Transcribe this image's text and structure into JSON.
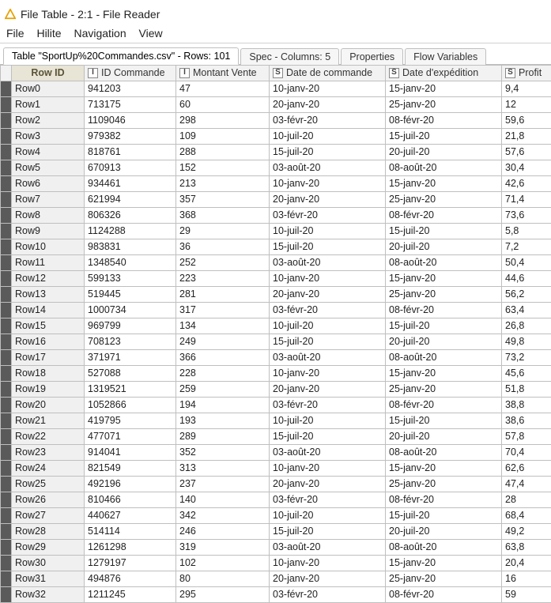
{
  "window": {
    "title": "File Table - 2:1 - File Reader"
  },
  "menu": {
    "items": [
      "File",
      "Hilite",
      "Navigation",
      "View"
    ]
  },
  "tabs": [
    {
      "label": "Table \"SportUp%20Commandes.csv\" - Rows: 101",
      "active": true
    },
    {
      "label": "Spec - Columns: 5",
      "active": false
    },
    {
      "label": "Properties",
      "active": false
    },
    {
      "label": "Flow Variables",
      "active": false
    }
  ],
  "table": {
    "rowid_header": "Row ID",
    "columns": [
      {
        "type": "I",
        "label": "ID Commande"
      },
      {
        "type": "I",
        "label": "Montant Vente"
      },
      {
        "type": "S",
        "label": "Date de commande"
      },
      {
        "type": "S",
        "label": "Date d'expédition"
      },
      {
        "type": "S",
        "label": "Profit"
      }
    ],
    "rows": [
      {
        "id": "Row0",
        "c": [
          "941203",
          "47",
          "10-janv-20",
          "15-janv-20",
          "9,4"
        ]
      },
      {
        "id": "Row1",
        "c": [
          "713175",
          "60",
          "20-janv-20",
          "25-janv-20",
          "12"
        ]
      },
      {
        "id": "Row2",
        "c": [
          "1109046",
          "298",
          "03-févr-20",
          "08-févr-20",
          "59,6"
        ]
      },
      {
        "id": "Row3",
        "c": [
          "979382",
          "109",
          "10-juil-20",
          "15-juil-20",
          "21,8"
        ]
      },
      {
        "id": "Row4",
        "c": [
          "818761",
          "288",
          "15-juil-20",
          "20-juil-20",
          "57,6"
        ]
      },
      {
        "id": "Row5",
        "c": [
          "670913",
          "152",
          "03-août-20",
          "08-août-20",
          "30,4"
        ]
      },
      {
        "id": "Row6",
        "c": [
          "934461",
          "213",
          "10-janv-20",
          "15-janv-20",
          "42,6"
        ]
      },
      {
        "id": "Row7",
        "c": [
          "621994",
          "357",
          "20-janv-20",
          "25-janv-20",
          "71,4"
        ]
      },
      {
        "id": "Row8",
        "c": [
          "806326",
          "368",
          "03-févr-20",
          "08-févr-20",
          "73,6"
        ]
      },
      {
        "id": "Row9",
        "c": [
          "1124288",
          "29",
          "10-juil-20",
          "15-juil-20",
          "5,8"
        ]
      },
      {
        "id": "Row10",
        "c": [
          "983831",
          "36",
          "15-juil-20",
          "20-juil-20",
          "7,2"
        ]
      },
      {
        "id": "Row11",
        "c": [
          "1348540",
          "252",
          "03-août-20",
          "08-août-20",
          "50,4"
        ]
      },
      {
        "id": "Row12",
        "c": [
          "599133",
          "223",
          "10-janv-20",
          "15-janv-20",
          "44,6"
        ]
      },
      {
        "id": "Row13",
        "c": [
          "519445",
          "281",
          "20-janv-20",
          "25-janv-20",
          "56,2"
        ]
      },
      {
        "id": "Row14",
        "c": [
          "1000734",
          "317",
          "03-févr-20",
          "08-févr-20",
          "63,4"
        ]
      },
      {
        "id": "Row15",
        "c": [
          "969799",
          "134",
          "10-juil-20",
          "15-juil-20",
          "26,8"
        ]
      },
      {
        "id": "Row16",
        "c": [
          "708123",
          "249",
          "15-juil-20",
          "20-juil-20",
          "49,8"
        ]
      },
      {
        "id": "Row17",
        "c": [
          "371971",
          "366",
          "03-août-20",
          "08-août-20",
          "73,2"
        ]
      },
      {
        "id": "Row18",
        "c": [
          "527088",
          "228",
          "10-janv-20",
          "15-janv-20",
          "45,6"
        ]
      },
      {
        "id": "Row19",
        "c": [
          "1319521",
          "259",
          "20-janv-20",
          "25-janv-20",
          "51,8"
        ]
      },
      {
        "id": "Row20",
        "c": [
          "1052866",
          "194",
          "03-févr-20",
          "08-févr-20",
          "38,8"
        ]
      },
      {
        "id": "Row21",
        "c": [
          "419795",
          "193",
          "10-juil-20",
          "15-juil-20",
          "38,6"
        ]
      },
      {
        "id": "Row22",
        "c": [
          "477071",
          "289",
          "15-juil-20",
          "20-juil-20",
          "57,8"
        ]
      },
      {
        "id": "Row23",
        "c": [
          "914041",
          "352",
          "03-août-20",
          "08-août-20",
          "70,4"
        ]
      },
      {
        "id": "Row24",
        "c": [
          "821549",
          "313",
          "10-janv-20",
          "15-janv-20",
          "62,6"
        ]
      },
      {
        "id": "Row25",
        "c": [
          "492196",
          "237",
          "20-janv-20",
          "25-janv-20",
          "47,4"
        ]
      },
      {
        "id": "Row26",
        "c": [
          "810466",
          "140",
          "03-févr-20",
          "08-févr-20",
          "28"
        ]
      },
      {
        "id": "Row27",
        "c": [
          "440627",
          "342",
          "10-juil-20",
          "15-juil-20",
          "68,4"
        ]
      },
      {
        "id": "Row28",
        "c": [
          "514114",
          "246",
          "15-juil-20",
          "20-juil-20",
          "49,2"
        ]
      },
      {
        "id": "Row29",
        "c": [
          "1261298",
          "319",
          "03-août-20",
          "08-août-20",
          "63,8"
        ]
      },
      {
        "id": "Row30",
        "c": [
          "1279197",
          "102",
          "10-janv-20",
          "15-janv-20",
          "20,4"
        ]
      },
      {
        "id": "Row31",
        "c": [
          "494876",
          "80",
          "20-janv-20",
          "25-janv-20",
          "16"
        ]
      },
      {
        "id": "Row32",
        "c": [
          "1211245",
          "295",
          "03-févr-20",
          "08-févr-20",
          "59"
        ]
      }
    ]
  }
}
